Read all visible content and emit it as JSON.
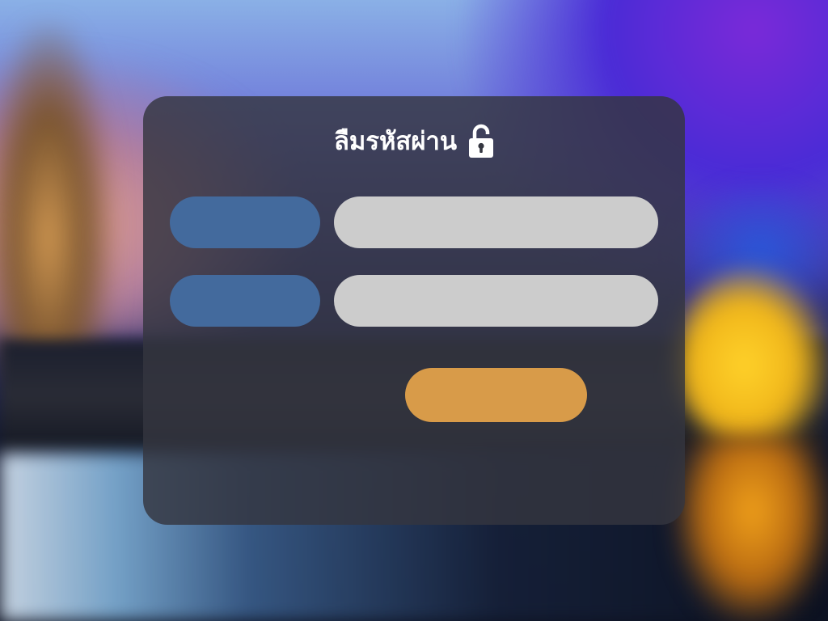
{
  "form": {
    "title": "ลืมรหัสผ่าน",
    "title_icon": "lock-icon",
    "fields": [
      {
        "label": "",
        "value": "",
        "placeholder": ""
      },
      {
        "label": "",
        "value": "",
        "placeholder": ""
      }
    ],
    "submit_label": ""
  },
  "colors": {
    "card_background": "#343640",
    "label_pill": "#436a9d",
    "input_pill": "#cccccc",
    "submit_button": "#d89b49",
    "title_text": "#ffffff"
  }
}
